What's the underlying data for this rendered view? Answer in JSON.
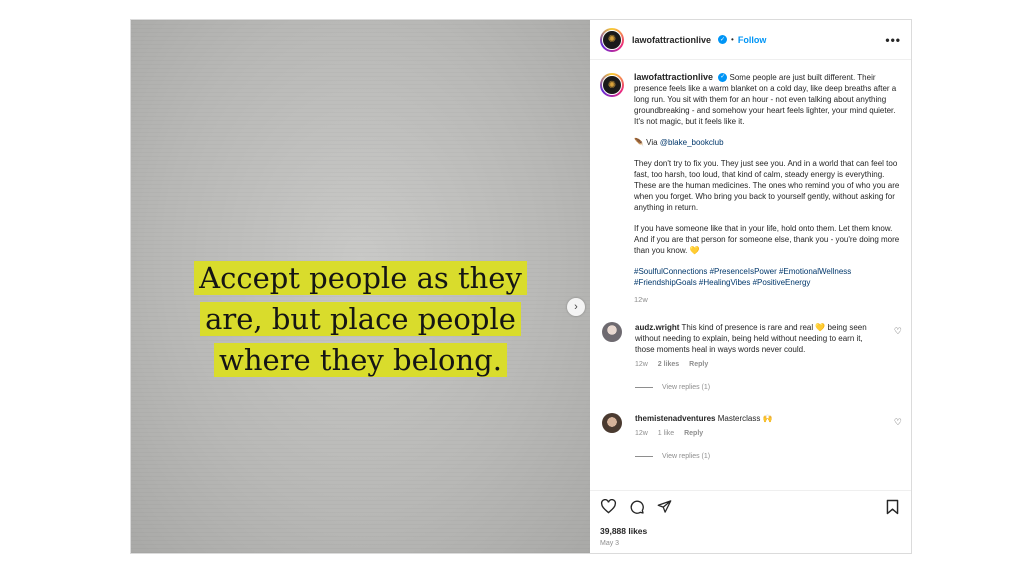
{
  "image_quote": {
    "line1": "Accept people as they",
    "line2": "are, but place people",
    "line3": "where they belong."
  },
  "header": {
    "username": "lawofattractionlive",
    "separator": "•",
    "follow_label": "Follow",
    "more_label": "•••"
  },
  "caption": {
    "username": "lawofattractionlive",
    "para1": "Some people are just built different. Their presence feels like a warm blanket on a cold day, like deep breaths after a long run. You sit with them for an hour - not even talking about anything groundbreaking - and somehow your heart feels lighter, your mind quieter. It's not magic, but it feels like it.",
    "via_prefix": "🪶 Via ",
    "via_handle": "@blake_bookclub",
    "para2": "They don't try to fix you. They just see you. And in a world that can feel too fast, too harsh, too loud, that kind of calm, steady energy is everything. These are the human medicines. The ones who remind you of who you are when you forget. Who bring you back to yourself gently, without asking for anything in return.",
    "para3": "If you have someone like that in your life, hold onto them. Let them know. And if you are that person for someone else, thank you - you're doing more than you know. 💛",
    "hashtags": "#SoulfulConnections #PresenceIsPower #EmotionalWellness #FriendshipGoals #HealingVibes #PositiveEnergy",
    "age": "12w"
  },
  "comments": [
    {
      "username": "audz.wright",
      "text": "This kind of presence is rare and real 💛 being seen without needing to explain, being held without needing to earn it, those moments heal in ways words never could.",
      "age": "12w",
      "likes": "2 likes",
      "reply_label": "Reply",
      "view_replies": "View replies (1)"
    },
    {
      "username": "themistenadventures",
      "text": "Masterclass 🙌",
      "age": "12w",
      "likes": "1 like",
      "reply_label": "Reply",
      "view_replies": "View replies (1)"
    }
  ],
  "footer": {
    "likes_count": "39,888 likes",
    "date": "May 3"
  },
  "colors": {
    "accent_blue": "#0095f6",
    "highlight_yellow": "#d9dc2c"
  },
  "icons": [
    "heart-icon",
    "comment-icon",
    "share-icon",
    "bookmark-icon",
    "verified-icon",
    "chevron-right-icon",
    "more-icon"
  ]
}
